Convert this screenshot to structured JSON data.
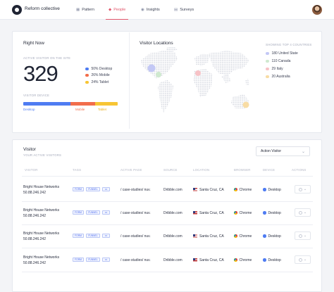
{
  "nav": {
    "brand": "Reform collective",
    "items": [
      {
        "label": "Pattern",
        "icon": "grid-icon"
      },
      {
        "label": "People",
        "icon": "drop-icon"
      },
      {
        "label": "Insights",
        "icon": "chart-icon"
      },
      {
        "label": "Surveys",
        "icon": "survey-icon"
      }
    ],
    "active": "People"
  },
  "right_now": {
    "title": "Right Now",
    "active_label": "ACTIVE VISITOR ON THE SITE",
    "active_count": "329",
    "devices": [
      {
        "label": "50% Desktop",
        "color": "#4f7cf2"
      },
      {
        "label": "26% Mobile",
        "color": "#f26d4b"
      },
      {
        "label": "24% Tablet",
        "color": "#f7c534"
      }
    ],
    "device_label": "VISITOR DEVICE",
    "device_share": [
      50,
      26,
      24
    ],
    "bar_labels": [
      "Desktop",
      "Mobile",
      "Tablet"
    ]
  },
  "locations": {
    "title": "Visitor Locations",
    "subtitle": "SHOWING TOP 4 COUNTRIES",
    "countries": [
      {
        "label": "180 United State",
        "color": "#c3c8f5"
      },
      {
        "label": "110 Canada",
        "color": "#cfe9cf"
      },
      {
        "label": "29 Italy",
        "color": "#f7c2c6"
      },
      {
        "label": "20 Australia",
        "color": "#f8dca4"
      }
    ]
  },
  "visitor": {
    "title": "Visitor",
    "subtitle": "YOUR ACTIVE VISITORS",
    "filter": "Action Visitor",
    "columns": [
      "VISITOR",
      "TAGS",
      "ACTIVE PAGE",
      "SOURCE",
      "LOCATION",
      "BROWSER",
      "DEVICE",
      "ACTIONS"
    ],
    "rows": [
      {
        "name": "Bright House Networks",
        "ip": "50.88.246.242",
        "tag1": "FORM",
        "tag2": "FUNNEL",
        "more": "•••",
        "page": "/ case-studies/ nuv.",
        "source": "Dribble.com",
        "location": "Santa Cruz, CA",
        "browser": "Chrome",
        "device": "Desktop"
      },
      {
        "name": "Bright House Networks",
        "ip": "50.88.246.242",
        "tag1": "FORM",
        "tag2": "FUNNEL",
        "more": "•••",
        "page": "/ case-studies/ nuv.",
        "source": "Dribble.com",
        "location": "Santa Cruz, CA",
        "browser": "Chrome",
        "device": "Desktop"
      },
      {
        "name": "Bright House Networks",
        "ip": "50.88.246.242",
        "tag1": "FORM",
        "tag2": "FUNNEL",
        "more": "•••",
        "page": "/ case-studies/ nuv.",
        "source": "Dribble.com",
        "location": "Santa Cruz, CA",
        "browser": "Chrome",
        "device": "Desktop"
      },
      {
        "name": "Bright House Networks",
        "ip": "50.88.246.242",
        "tag1": "FORM",
        "tag2": "FUNNEL",
        "more": "•••",
        "page": "/ case-studies/ nuv.",
        "source": "Dribble.com",
        "location": "Santa Cruz, CA",
        "browser": "Chrome",
        "device": "Desktop"
      }
    ]
  }
}
